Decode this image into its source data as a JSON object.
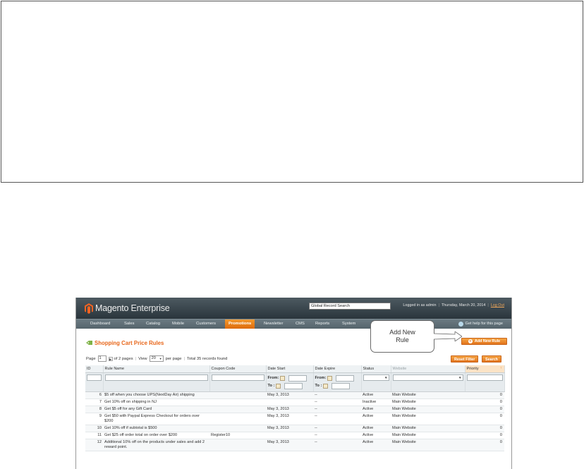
{
  "header": {
    "logo_brand": "Magento",
    "logo_edition": "Enterprise",
    "global_search_value": "Global Record Search",
    "logged_in": "Logged in as admin",
    "date": "Thursday, March 20, 2014",
    "logout": "Log Out"
  },
  "nav": {
    "items": [
      "Dashboard",
      "Sales",
      "Catalog",
      "Mobile",
      "Customers",
      "Promotions",
      "Newsletter",
      "CMS",
      "Reports",
      "System"
    ],
    "active": "Promotions",
    "help": "Get help for this page"
  },
  "page": {
    "title": "Shopping Cart Price Rules",
    "add_button": "Add New Rule",
    "reset_button": "Reset Filter",
    "search_button": "Search"
  },
  "callout": {
    "text": "Add New Rule"
  },
  "pager": {
    "page_label": "Page",
    "page_value": "1",
    "of_pages": "of 2 pages",
    "view_label": "View",
    "per_page_value": "20",
    "per_page_label": "per page",
    "total": "Total 35 records found"
  },
  "grid": {
    "columns": [
      "ID",
      "Rule Name",
      "Coupon Code",
      "Date Start",
      "Date Expire",
      "Status",
      "Website",
      "Priority"
    ],
    "filter_from": "From:",
    "filter_to": "To :",
    "rows": [
      {
        "id": "6",
        "name": "$5 off when you choose UPS(NextDay Air) shipping",
        "coupon": "",
        "start": "May 3, 2013",
        "expire": "--",
        "status": "Active",
        "website": "Main Website",
        "priority": "0"
      },
      {
        "id": "7",
        "name": "Get 10% off on shipping in NJ",
        "coupon": "",
        "start": "",
        "expire": "--",
        "status": "Inactive",
        "website": "Main Website",
        "priority": "0"
      },
      {
        "id": "8",
        "name": "Get $5 off for any Gift Card",
        "coupon": "",
        "start": "May 3, 2013",
        "expire": "--",
        "status": "Active",
        "website": "Main Website",
        "priority": "0"
      },
      {
        "id": "9",
        "name": "Get $50 with Paypal Express Checkout for orders over $200",
        "coupon": "",
        "start": "May 3, 2013",
        "expire": "--",
        "status": "Active",
        "website": "Main Website",
        "priority": "0"
      },
      {
        "id": "10",
        "name": "Get 10% off if subtotal is $500",
        "coupon": "",
        "start": "May 3, 2013",
        "expire": "--",
        "status": "Active",
        "website": "Main Website",
        "priority": "0"
      },
      {
        "id": "11",
        "name": "Get $25 off order total on order over $200",
        "coupon": "Register10",
        "start": "",
        "expire": "--",
        "status": "Active",
        "website": "Main Website",
        "priority": "0"
      },
      {
        "id": "12",
        "name": "Additional 10% off on the products under sales and add 2 reward point.",
        "coupon": "",
        "start": "May 3, 2013",
        "expire": "--",
        "status": "Active",
        "website": "Main Website",
        "priority": "0"
      }
    ]
  },
  "colors": {
    "accent": "#e8671b",
    "header_dark": "#2a353c",
    "nav": "#5d6c74"
  }
}
